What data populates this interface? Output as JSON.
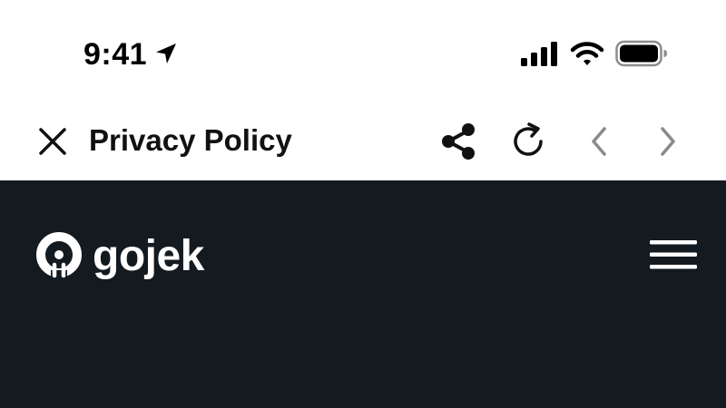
{
  "status_bar": {
    "time": "9:41",
    "icons": [
      "location-arrow-icon",
      "cellular-signal-icon",
      "wifi-icon",
      "battery-icon"
    ]
  },
  "toolbar": {
    "title": "Privacy Policy",
    "icons": [
      "close-icon",
      "share-icon",
      "reload-icon",
      "chevron-left-icon",
      "chevron-right-icon"
    ]
  },
  "web": {
    "brand_name": "gojek",
    "icons": [
      "gojek-logo-icon",
      "hamburger-menu-icon"
    ]
  },
  "colors": {
    "toolbar_bg": "#ffffff",
    "content_bg": "#131a20",
    "text_dark": "#111111",
    "nav_disabled": "#8a8a8a",
    "brand_text": "#ffffff"
  }
}
